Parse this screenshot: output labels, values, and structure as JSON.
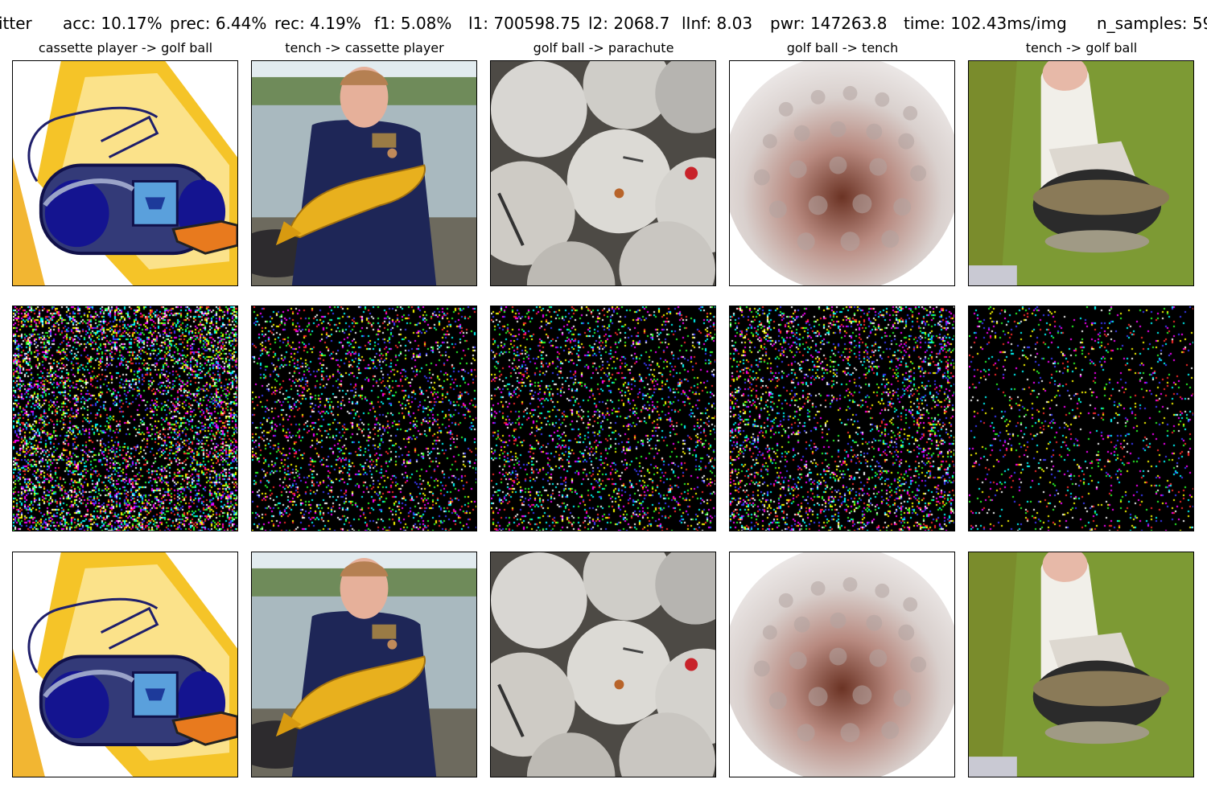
{
  "header": {
    "stats": [
      "itter",
      "acc: 10.17%",
      "prec: 6.44%",
      "rec: 4.19%",
      "f1: 5.08%",
      "l1: 700598.75",
      "l2: 2068.7",
      "lInf: 8.03",
      "pwr: 147263.8",
      "time: 102.43ms/img",
      "n_samples: 59"
    ]
  },
  "columns": [
    {
      "title": "cassette player -> golf ball",
      "subject": "boombox-clipart",
      "noise_density": "high"
    },
    {
      "title": "tench -> cassette player",
      "subject": "boy-holding-fish",
      "noise_density": "medium"
    },
    {
      "title": "golf ball -> parachute",
      "subject": "pile-of-golf-balls",
      "noise_density": "medium"
    },
    {
      "title": "golf ball -> tench",
      "subject": "single-golf-ball",
      "noise_density": "medium"
    },
    {
      "title": "tench -> golf ball",
      "subject": "person-with-fish-on-grass",
      "noise_density": "low"
    }
  ],
  "colors": {
    "background": "#ffffff",
    "noise_background": "#000000",
    "noise_dots": [
      "#ff2b2b",
      "#2bff2b",
      "#3b3bff",
      "#ffffff",
      "#ff00ff",
      "#00ffff",
      "#ffff00"
    ]
  }
}
